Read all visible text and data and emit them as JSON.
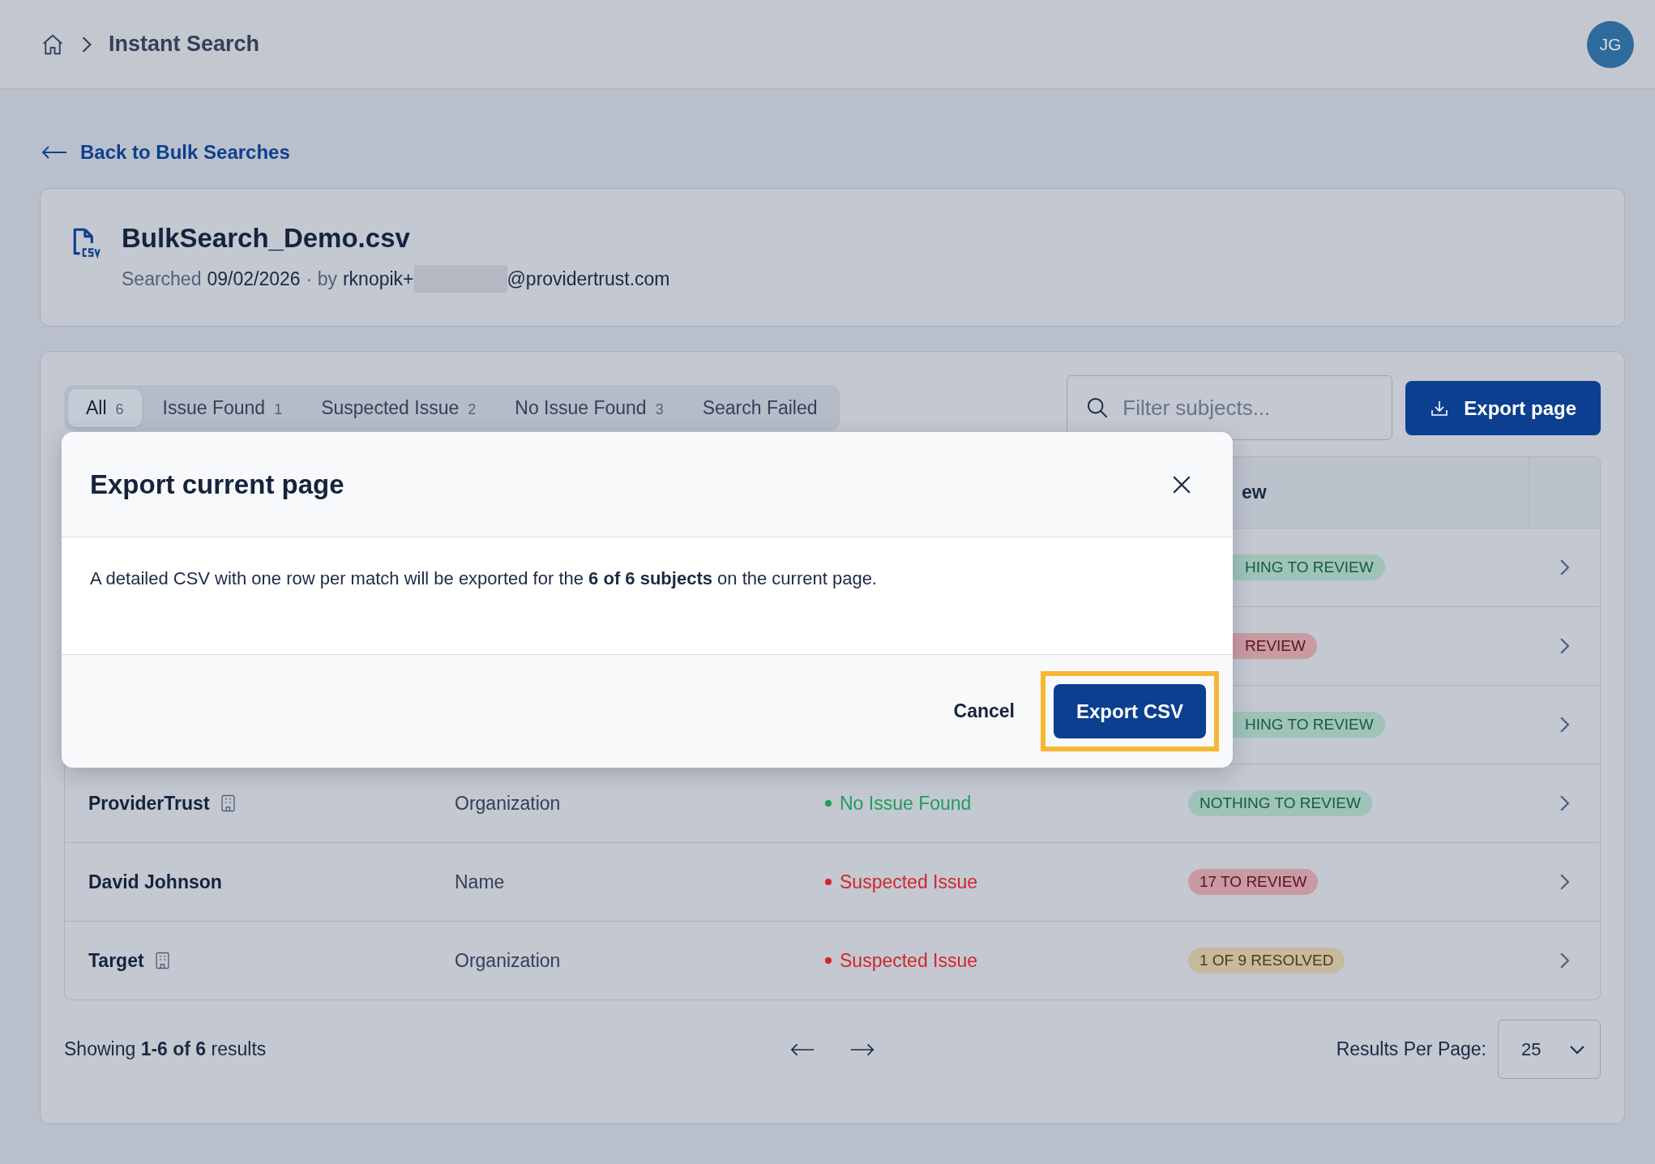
{
  "breadcrumb": {
    "current": "Instant Search"
  },
  "user": {
    "initials": "JG"
  },
  "back_link": "Back to Bulk Searches",
  "file": {
    "name": "BulkSearch_Demo.csv",
    "searched_label": "Searched",
    "date": "09/02/2026",
    "by_label": "· by",
    "email_prefix": "rknopik+",
    "email_redacted": true,
    "email_suffix": "@providertrust.com"
  },
  "tabs": [
    {
      "label": "All",
      "count": "6",
      "selected": true
    },
    {
      "label": "Issue Found",
      "count": "1",
      "selected": false
    },
    {
      "label": "Suspected Issue",
      "count": "2",
      "selected": false
    },
    {
      "label": "No Issue Found",
      "count": "3",
      "selected": false
    },
    {
      "label": "Search Failed",
      "selected": false
    }
  ],
  "search": {
    "placeholder": "Filter subjects..."
  },
  "export_button": "Export page",
  "table": {
    "columns": [
      {
        "label": "ew"
      }
    ],
    "rows": [
      {
        "badge": {
          "text": "HING TO REVIEW",
          "kind": "green"
        }
      },
      {
        "badge": {
          "text": "REVIEW",
          "kind": "red"
        }
      },
      {
        "badge": {
          "text": "HING TO REVIEW",
          "kind": "green"
        }
      },
      {
        "name": "ProviderTrust",
        "organization": true,
        "type": "Organization",
        "status": "No Issue Found",
        "color": "#1f9d5c",
        "badge": {
          "text": "NOTHING TO REVIEW",
          "kind": "green"
        }
      },
      {
        "name": "David Johnson",
        "organization": false,
        "type": "Name",
        "status": "Suspected Issue",
        "color": "#d2262c",
        "badge": {
          "text": "17 TO REVIEW",
          "kind": "red"
        }
      },
      {
        "name": "Target",
        "organization": true,
        "type": "Organization",
        "status": "Suspected Issue",
        "color": "#d2262c",
        "badge": {
          "text": "1 OF 9 RESOLVED",
          "kind": "tan"
        }
      }
    ]
  },
  "footer": {
    "showing": "Showing **1-6 of 6** results",
    "per_page_label": "Results Per Page:",
    "per_page": "25"
  },
  "modal": {
    "title": "Export current page",
    "body": "A detailed CSV with one row per match will be exported for the **6 of 6 subjects** on the current page.",
    "cancel": "Cancel",
    "confirm": "Export CSV",
    "confirm_focused": true
  }
}
